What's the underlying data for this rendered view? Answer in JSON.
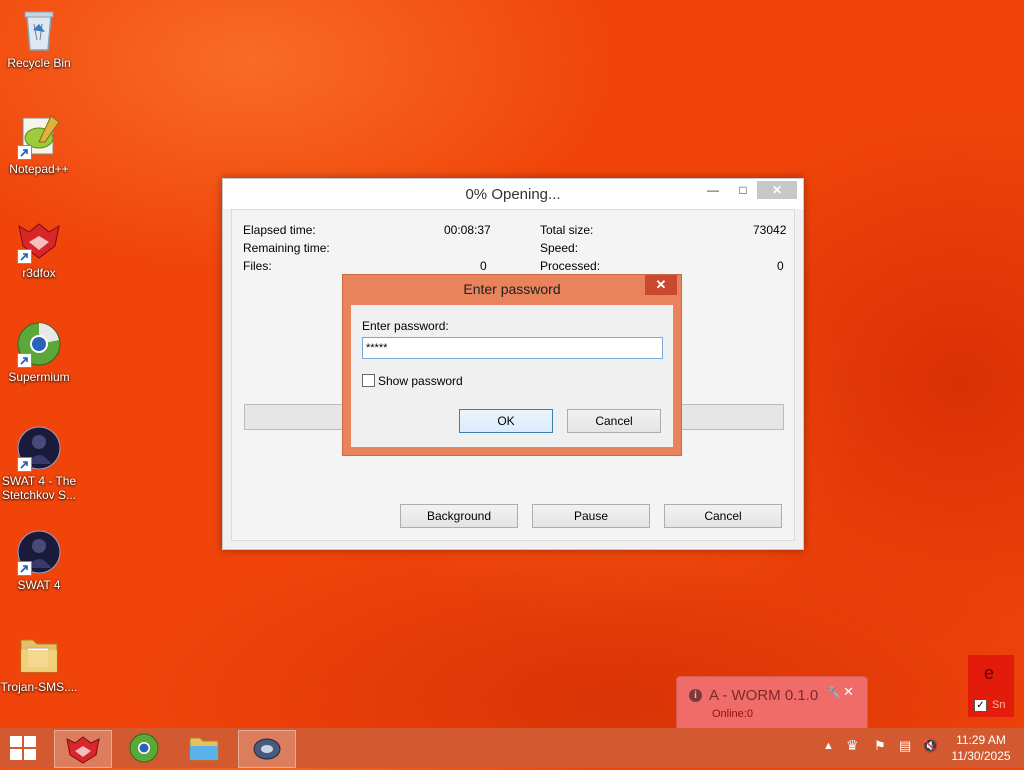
{
  "desktop": {
    "icons": [
      {
        "label": "Recycle Bin"
      },
      {
        "label": "Notepad++"
      },
      {
        "label": "r3dfox"
      },
      {
        "label": "Supermium"
      },
      {
        "label": "SWAT 4 - The Stetchkov S..."
      },
      {
        "label": "SWAT 4"
      },
      {
        "label": "Trojan-SMS...."
      }
    ]
  },
  "progress_window": {
    "title": "0% Opening...",
    "left": {
      "elapsed_label": "Elapsed time:",
      "elapsed_value": "00:08:37",
      "remaining_label": "Remaining time:",
      "files_label": "Files:",
      "files_value": "0"
    },
    "right": {
      "total_label": "Total size:",
      "total_value": "73042",
      "speed_label": "Speed:",
      "processed_label": "Processed:",
      "processed_value": "0"
    },
    "progress_percent": 0,
    "buttons": {
      "background": "Background",
      "pause": "Pause",
      "cancel": "Cancel"
    }
  },
  "password_dialog": {
    "title": "Enter password",
    "prompt": "Enter password:",
    "value": "*****",
    "show_password": "Show password",
    "show_password_checked": false,
    "ok": "OK",
    "cancel": "Cancel"
  },
  "notification": {
    "title": "A - WORM 0.1.0",
    "status": "Online:0"
  },
  "edge_widget": {
    "letter": "e",
    "label": "Sn",
    "checked": true
  },
  "taskbar": {
    "time": "11:29 AM",
    "date": "11/30/2025"
  },
  "colors": {
    "desktop": "#f0440a",
    "taskbar": "#d35a30",
    "dialog_frame": "#e8835b",
    "notification": "#f06c68"
  }
}
